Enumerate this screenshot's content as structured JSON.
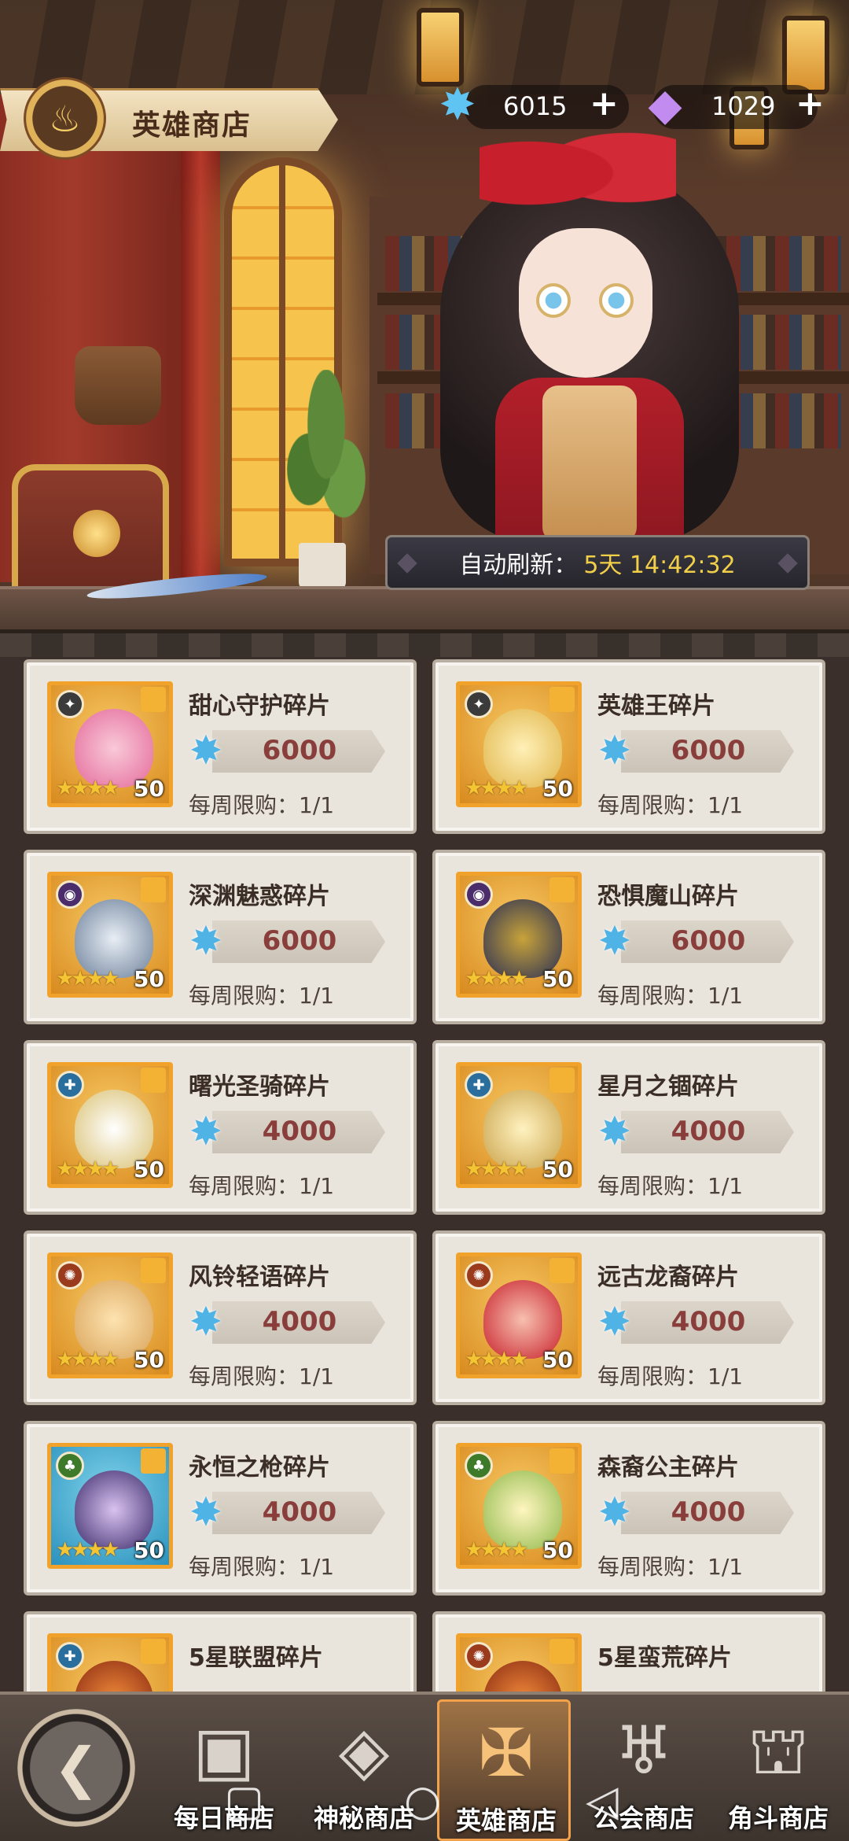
{
  "header": {
    "title": "英雄商店"
  },
  "currency": [
    {
      "name": "snowflake-currency",
      "value": "6015",
      "plus": "+"
    },
    {
      "name": "diamond-currency",
      "value": "1029",
      "plus": "+"
    }
  ],
  "refresh": {
    "label": "自动刷新：",
    "value": "5天 14:42:32"
  },
  "items": [
    {
      "name": "甜心守护碎片",
      "price": "6000",
      "limit": "每周限购：1/1",
      "count": "50",
      "stars": "★★★★"
    },
    {
      "name": "英雄王碎片",
      "price": "6000",
      "limit": "每周限购：1/1",
      "count": "50",
      "stars": "★★★★"
    },
    {
      "name": "深渊魅惑碎片",
      "price": "6000",
      "limit": "每周限购：1/1",
      "count": "50",
      "stars": "★★★★"
    },
    {
      "name": "恐惧魔山碎片",
      "price": "6000",
      "limit": "每周限购：1/1",
      "count": "50",
      "stars": "★★★★"
    },
    {
      "name": "曙光圣骑碎片",
      "price": "4000",
      "limit": "每周限购：1/1",
      "count": "50",
      "stars": "★★★★"
    },
    {
      "name": "星月之锢碎片",
      "price": "4000",
      "limit": "每周限购：1/1",
      "count": "50",
      "stars": "★★★★"
    },
    {
      "name": "风铃轻语碎片",
      "price": "4000",
      "limit": "每周限购：1/1",
      "count": "50",
      "stars": "★★★★"
    },
    {
      "name": "远古龙裔碎片",
      "price": "4000",
      "limit": "每周限购：1/1",
      "count": "50",
      "stars": "★★★★"
    },
    {
      "name": "永恒之枪碎片",
      "price": "4000",
      "limit": "每周限购：1/1",
      "count": "50",
      "stars": "★★★★"
    },
    {
      "name": "森裔公主碎片",
      "price": "4000",
      "limit": "每周限购：1/1",
      "count": "50",
      "stars": "★★★★"
    },
    {
      "name": "5星联盟碎片",
      "price": "",
      "limit": "",
      "count": "",
      "stars": ""
    },
    {
      "name": "5星蛮荒碎片",
      "price": "",
      "limit": "",
      "count": "",
      "stars": ""
    }
  ],
  "nav": {
    "back_icon": "back-arrow-icon",
    "tabs": [
      {
        "label": "每日商店",
        "icon": "gift-box-icon",
        "active": false
      },
      {
        "label": "神秘商店",
        "icon": "diamond-icon",
        "active": false
      },
      {
        "label": "英雄商店",
        "icon": "sword-icon",
        "active": true
      },
      {
        "label": "公会商店",
        "icon": "wings-icon",
        "active": false
      },
      {
        "label": "角斗商店",
        "icon": "colosseum-icon",
        "active": false
      }
    ]
  },
  "colors": {
    "accent_gold": "#f1cf49",
    "price_red": "#8a3e3b",
    "card_bg": "#e9e4dc"
  }
}
